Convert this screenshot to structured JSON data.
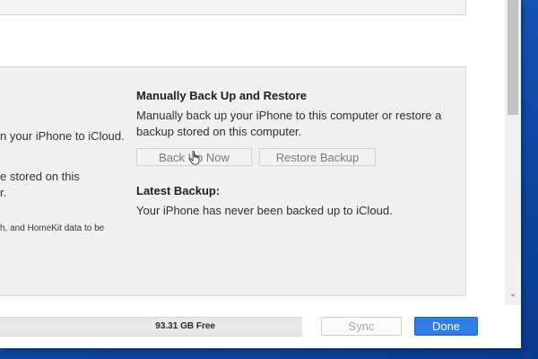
{
  "left_column": {
    "line1": "n your iPhone to iCloud.",
    "line2": "e stored on this",
    "line3": "r.",
    "line4": "h, and HomeKit data to be"
  },
  "manual_backup": {
    "heading": "Manually Back Up and Restore",
    "description_line1": "Manually back up your iPhone to this computer or restore a",
    "description_line2": "backup stored on this computer.",
    "back_up_now_label": "Back Up Now",
    "restore_backup_label": "Restore Backup"
  },
  "latest_backup": {
    "heading": "Latest Backup:",
    "status": "Your iPhone has never been backed up to iCloud."
  },
  "bottom_bar": {
    "free_space": "93.31 GB Free",
    "sync_label": "Sync",
    "done_label": "Done"
  },
  "colors": {
    "done_button": "#2f7ee6",
    "panel_background": "#f0f0f0",
    "desktop_background": "#1a66c9"
  },
  "icons": {
    "cursor": "hand-pointer-icon",
    "scroll_down": "chevron-down-icon"
  }
}
